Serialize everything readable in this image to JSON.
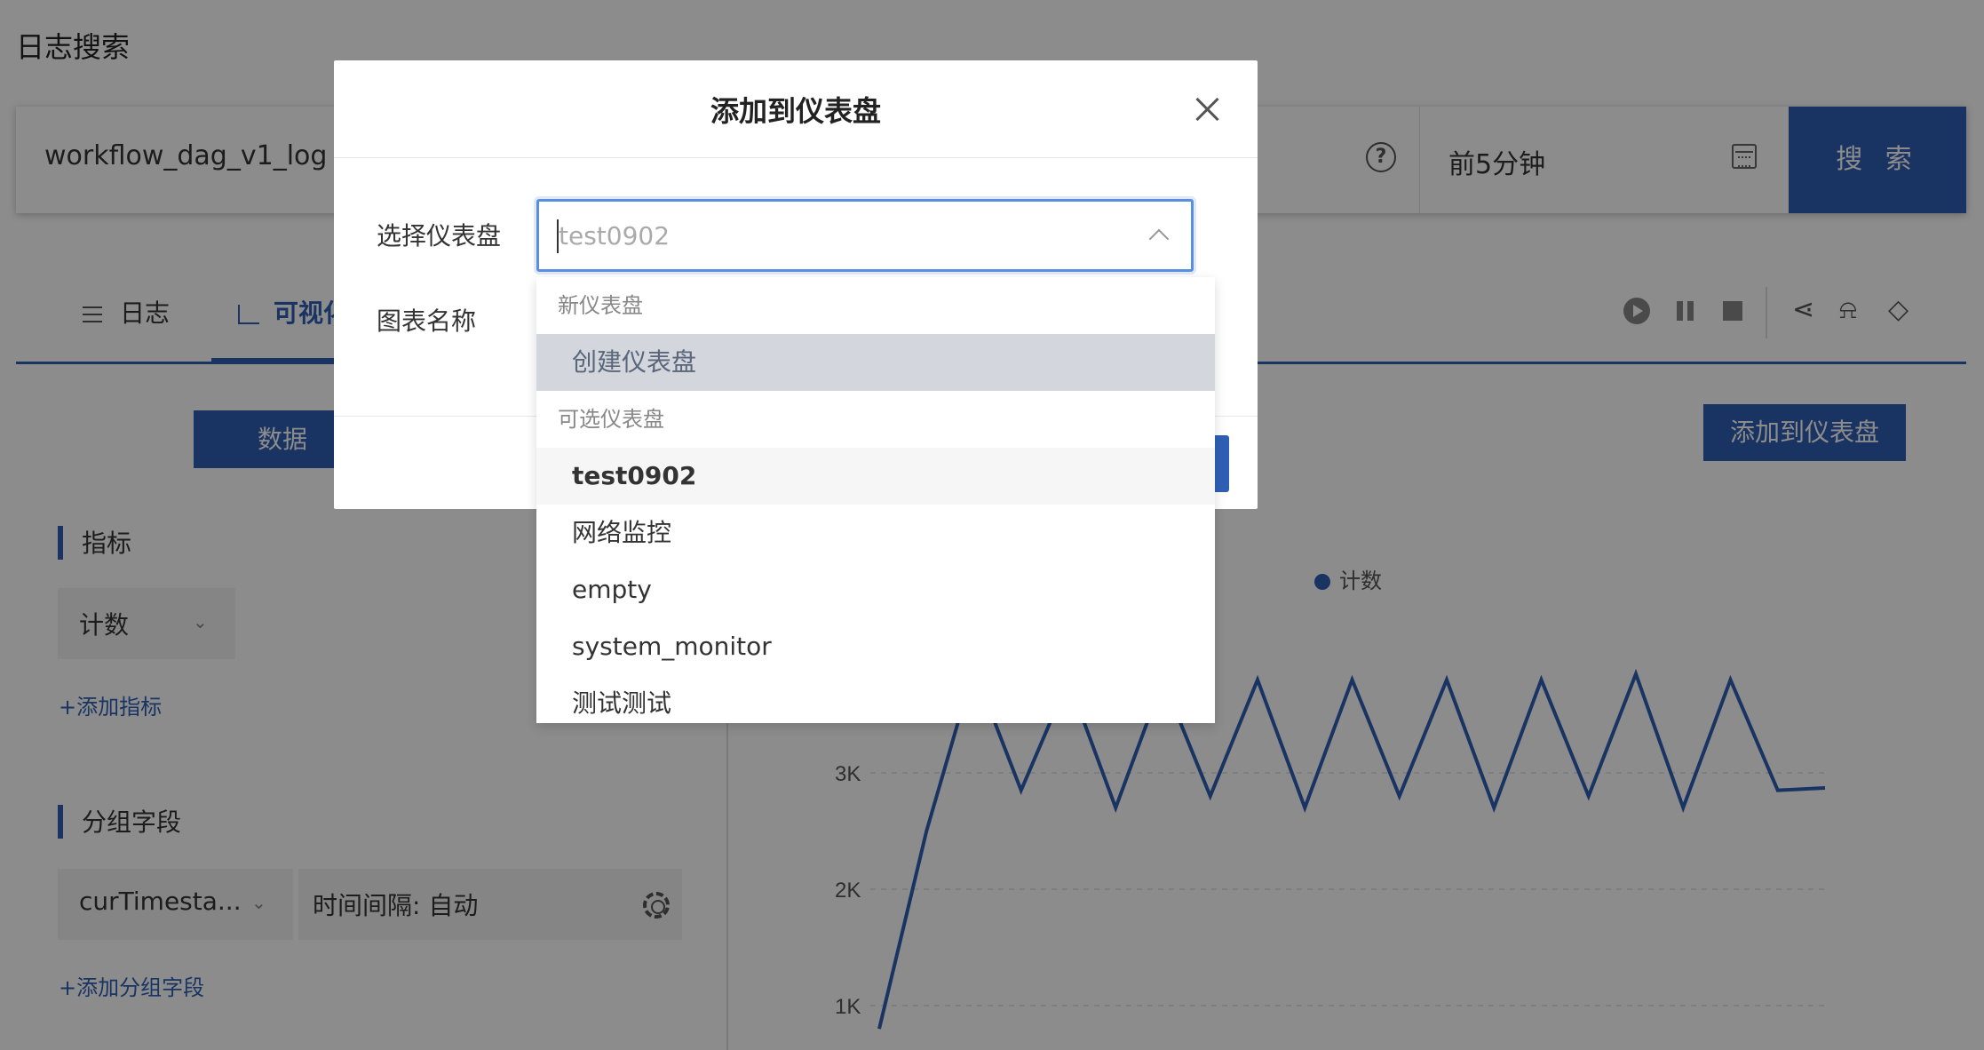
{
  "page": {
    "title": "日志搜索"
  },
  "search": {
    "query": "workflow_dag_v1_log",
    "help_icon": "question-circle-icon",
    "time_range": "前5分钟",
    "calendar_icon": "calendar-icon",
    "button_label": "搜 索"
  },
  "tabs": [
    {
      "label": "日志",
      "icon": "list-icon"
    },
    {
      "label": "可视化",
      "icon": "line-chart-icon",
      "active": true
    }
  ],
  "toolbar": {
    "icons": [
      "play-icon",
      "pause-icon",
      "stop-icon",
      "share-icon",
      "alert-icon",
      "eraser-icon"
    ]
  },
  "left_panel": {
    "data_tab": "数据",
    "metrics": {
      "title": "指标",
      "field": "计数",
      "add_link": "+添加指标"
    },
    "group": {
      "title": "分组字段",
      "field": "curTimesta...",
      "interval": "时间间隔: 自动",
      "add_link": "+添加分组字段"
    }
  },
  "right_panel": {
    "add_button": "添加到仪表盘"
  },
  "chart_data": {
    "type": "line",
    "legend": [
      "计数"
    ],
    "series": [
      {
        "name": "计数",
        "values": [
          800,
          2500,
          3900,
          2850,
          3800,
          2700,
          3800,
          2800,
          3800,
          2700,
          3800,
          2800,
          3800,
          2700,
          3800,
          2800,
          3850,
          2700,
          3800,
          2850,
          2870
        ]
      }
    ],
    "y_ticks": [
      "1K",
      "2K",
      "3K"
    ],
    "grid": "dashed horizontal",
    "color": "#2f5fb5"
  },
  "modal": {
    "title": "添加到仪表盘",
    "close_icon": "close-icon",
    "select_label": "选择仪表盘",
    "select_value": "test0902",
    "chart_name_label": "图表名称",
    "dropdown": {
      "new_group_title": "新仪表盘",
      "create_option": "创建仪表盘",
      "existing_group_title": "可选仪表盘",
      "options": [
        "test0902",
        "网络监控",
        "empty",
        "system_monitor",
        "测试测试"
      ]
    }
  }
}
